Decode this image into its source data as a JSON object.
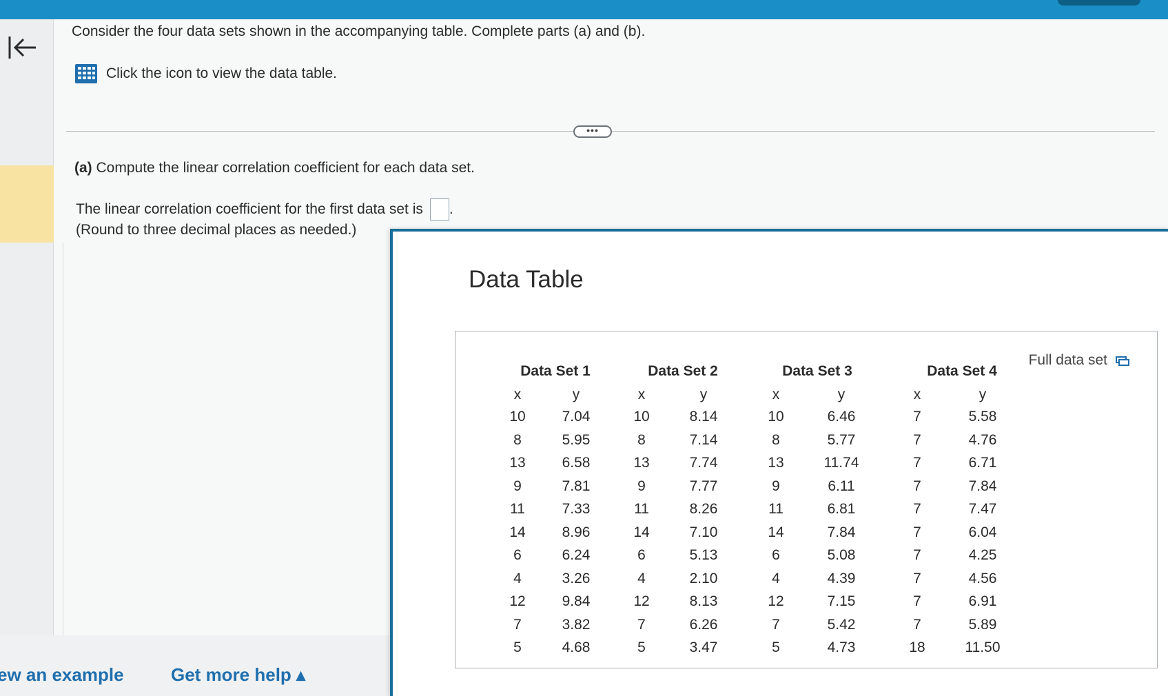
{
  "question": "Consider the four data sets shown in the accompanying table. Complete parts (a) and (b).",
  "table_link": "Click the icon to view the data table.",
  "more_label": "•••",
  "part_a": {
    "label": "(a)",
    "text": "Compute the linear correlation coefficient for each data set."
  },
  "answer_prompt": "The linear correlation coefficient for the first data set is",
  "answer_value": "",
  "round_note": "(Round to three decimal places as needed.)",
  "bottom": {
    "example": "ew an example",
    "help": "Get more help ▴"
  },
  "popup": {
    "title": "Data Table",
    "full_data_set": "Full data set",
    "datasets": [
      {
        "name": "Data Set 1",
        "x_label": "x",
        "y_label": "y",
        "x": [
          "10",
          "8",
          "13",
          "9",
          "11",
          "14",
          "6",
          "4",
          "12",
          "7",
          "5"
        ],
        "y": [
          "7.04",
          "5.95",
          "6.58",
          "7.81",
          "7.33",
          "8.96",
          "6.24",
          "3.26",
          "9.84",
          "3.82",
          "4.68"
        ]
      },
      {
        "name": "Data Set 2",
        "x_label": "x",
        "y_label": "y",
        "x": [
          "10",
          "8",
          "13",
          "9",
          "11",
          "14",
          "6",
          "4",
          "12",
          "7",
          "5"
        ],
        "y": [
          "8.14",
          "7.14",
          "7.74",
          "7.77",
          "8.26",
          "7.10",
          "5.13",
          "2.10",
          "8.13",
          "6.26",
          "3.47"
        ]
      },
      {
        "name": "Data Set 3",
        "x_label": "x",
        "y_label": "y",
        "x": [
          "10",
          "8",
          "13",
          "9",
          "11",
          "14",
          "6",
          "4",
          "12",
          "7",
          "5"
        ],
        "y": [
          "6.46",
          "5.77",
          "11.74",
          "6.11",
          "6.81",
          "7.84",
          "5.08",
          "4.39",
          "7.15",
          "5.42",
          "4.73"
        ]
      },
      {
        "name": "Data Set 4",
        "x_label": "x",
        "y_label": "y",
        "x": [
          "7",
          "7",
          "7",
          "7",
          "7",
          "7",
          "7",
          "7",
          "7",
          "7",
          "18"
        ],
        "y": [
          "5.58",
          "4.76",
          "6.71",
          "7.84",
          "7.47",
          "6.04",
          "4.25",
          "4.56",
          "6.91",
          "5.89",
          "11.50"
        ]
      }
    ]
  },
  "colors": {
    "topbar": "#1a8fc7",
    "link": "#1f6fae",
    "highlight": "#f8e3a3"
  }
}
